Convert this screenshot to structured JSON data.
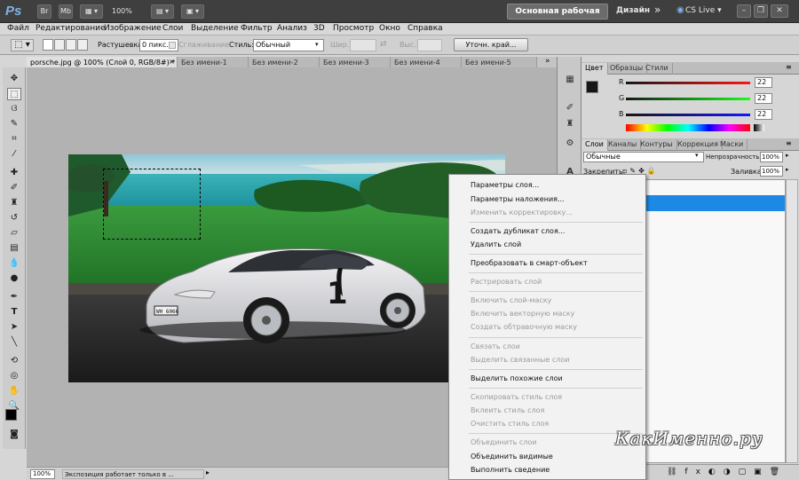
{
  "app": {
    "logo": "Ps",
    "bridge": "Br",
    "minibridge": "Mb",
    "zoom": "100%",
    "workspace": "Основная рабочая среда",
    "design": "Дизайн",
    "more": "»",
    "cslive": "CS Live ▾"
  },
  "menu": [
    "Файл",
    "Редактирование",
    "Изображение",
    "Слои",
    "Выделение",
    "Фильтр",
    "Анализ",
    "3D",
    "Просмотр",
    "Окно",
    "Справка"
  ],
  "options": {
    "feather_label": "Растушевка:",
    "feather_value": "0 пикс.",
    "antialias": "Сглаживание",
    "style_label": "Стиль:",
    "style_value": "Обычный",
    "width_label": "Шир.:",
    "height_label": "Выс.:",
    "refine": "Уточн. край..."
  },
  "tabs": [
    "porsche.jpg @ 100% (Слой 0, RGB/8#) *",
    "Без имени-1",
    "Без имени-2",
    "Без имени-3",
    "Без имени-4",
    "Без имени-5"
  ],
  "status": {
    "zoom": "100%",
    "text": "Экспозиция работает только в ..."
  },
  "color_panel": {
    "tabs": [
      "Цвет",
      "Образцы",
      "Стили"
    ],
    "r_label": "R",
    "g_label": "G",
    "b_label": "B",
    "r": "22",
    "g": "22",
    "b": "22"
  },
  "layers_panel": {
    "tabs": [
      "Слои",
      "Каналы",
      "Контуры",
      "Коррекция",
      "Маски"
    ],
    "blend": "Обычные",
    "opacity_label": "Непрозрачность:",
    "opacity": "100%",
    "lock_label": "Закрепить:",
    "fill_label": "Заливка:",
    "fill": "100%"
  },
  "context_menu": {
    "items": [
      {
        "label": "Параметры слоя...",
        "enabled": true
      },
      {
        "label": "Параметры наложения...",
        "enabled": true
      },
      {
        "label": "Изменить корректировку...",
        "enabled": false
      },
      {
        "label": "Создать дубликат слоя...",
        "enabled": true
      },
      {
        "label": "Удалить слой",
        "enabled": true
      },
      {
        "label": "Преобразовать в смарт-объект",
        "enabled": true
      },
      {
        "label": "Растрировать слой",
        "enabled": false
      },
      {
        "label": "Включить слой-маску",
        "enabled": false
      },
      {
        "label": "Включить векторную маску",
        "enabled": false
      },
      {
        "label": "Создать обтравочную маску",
        "enabled": false
      },
      {
        "label": "Связать слои",
        "enabled": false
      },
      {
        "label": "Выделить связанные слои",
        "enabled": false
      },
      {
        "label": "Выделить похожие слои",
        "enabled": true
      },
      {
        "label": "Скопировать стиль слоя",
        "enabled": false
      },
      {
        "label": "Вклеить стиль слоя",
        "enabled": false
      },
      {
        "label": "Очистить стиль слоя",
        "enabled": false
      },
      {
        "label": "Объединить слои",
        "enabled": false
      },
      {
        "label": "Объединить видимые",
        "enabled": true
      },
      {
        "label": "Выполнить сведение",
        "enabled": true
      }
    ]
  },
  "image": {
    "plate": "WH 6066",
    "door_number": "1"
  },
  "watermark": "КакИменно.ру",
  "colors": {
    "accent": "#1e90ff",
    "appbar": "#3f3f3f",
    "selected_layer": "#1e88e5"
  }
}
